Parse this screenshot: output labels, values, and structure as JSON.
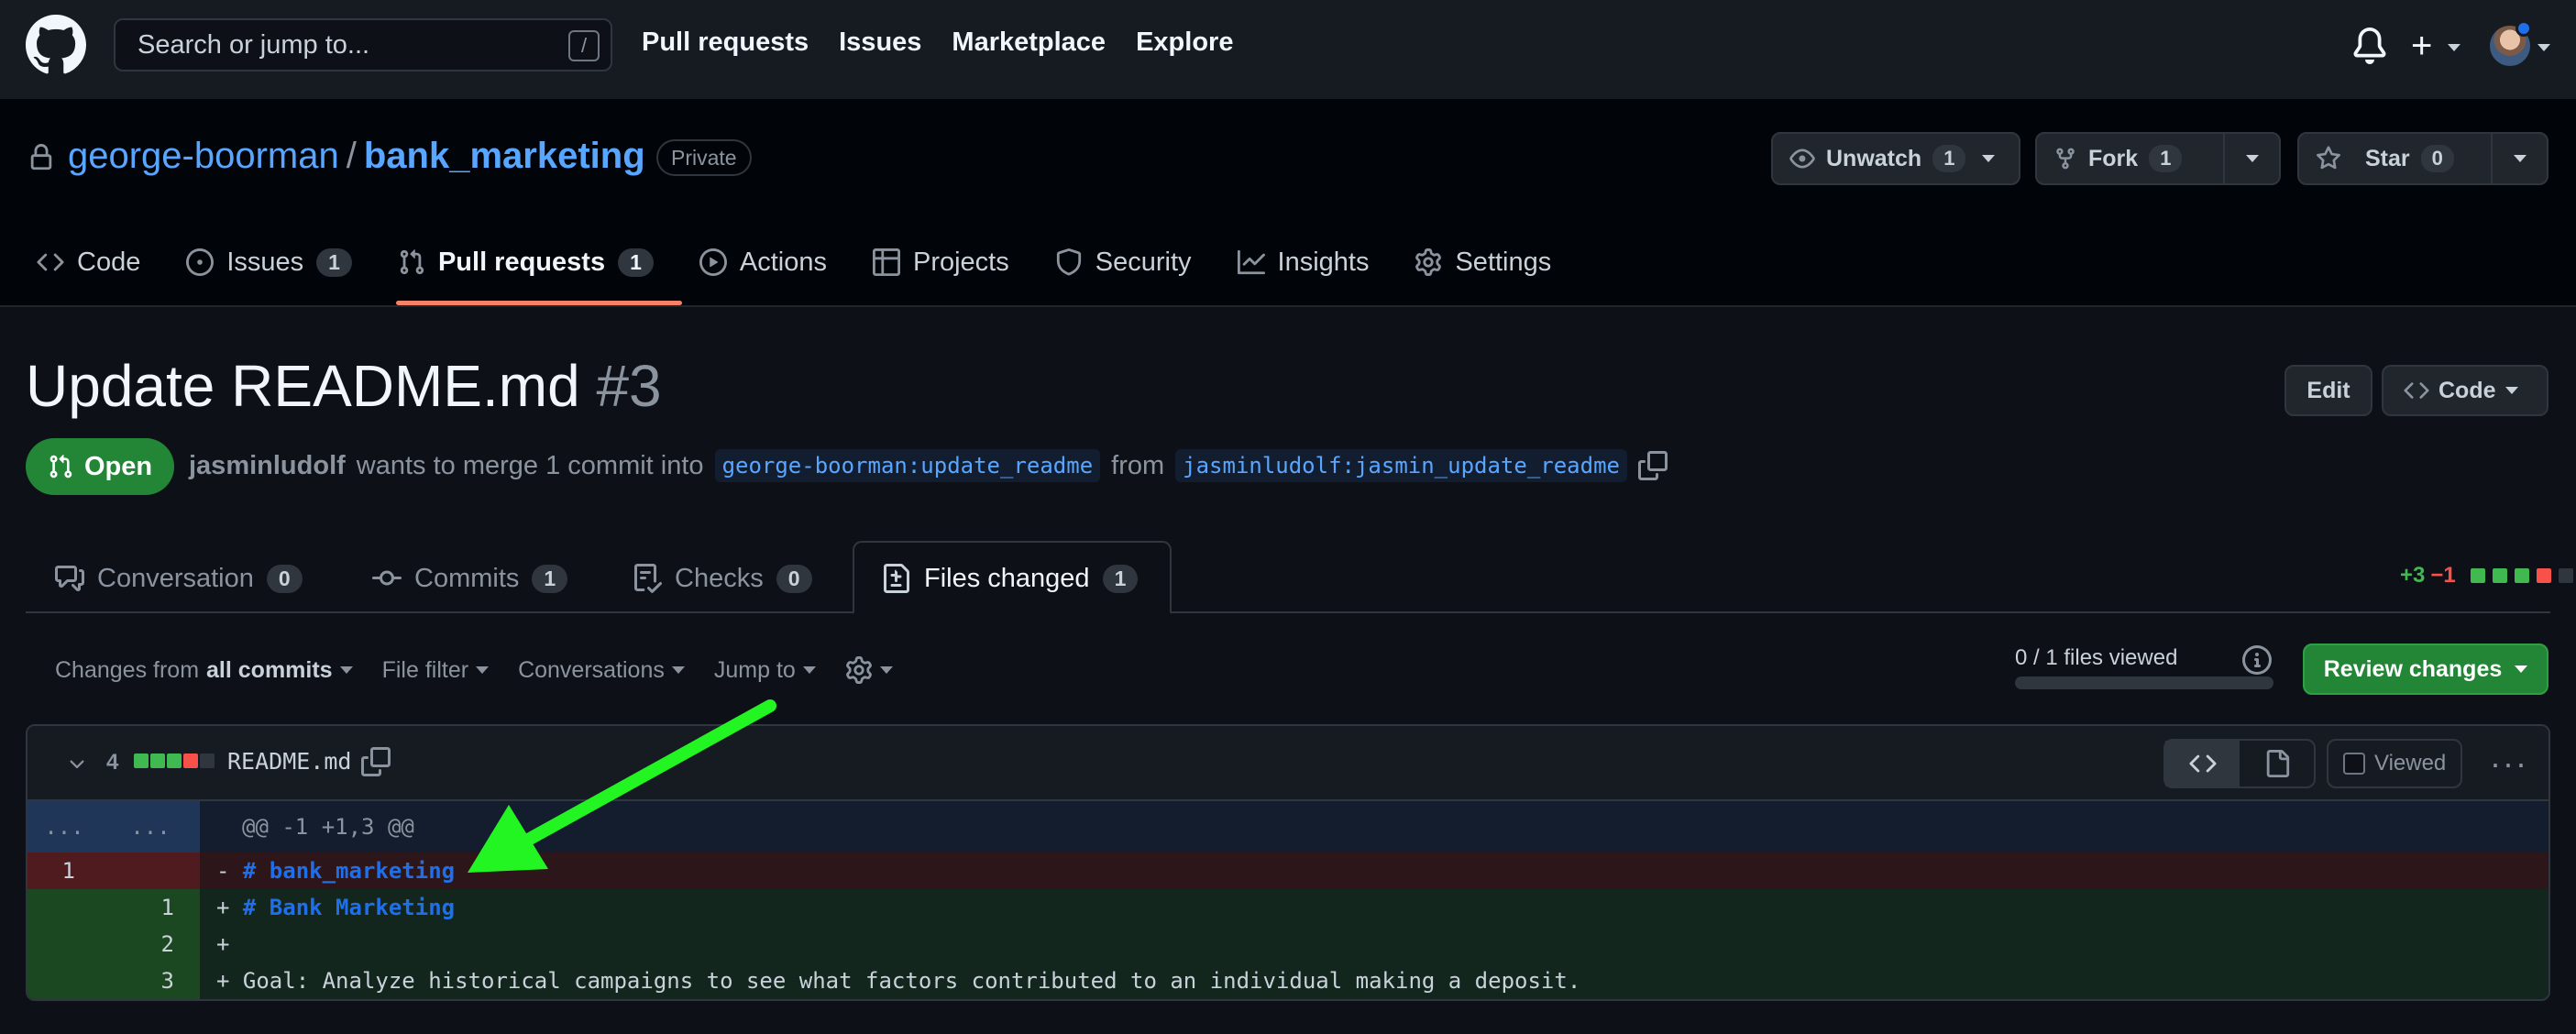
{
  "topbar": {
    "search_placeholder": "Search or jump to...",
    "search_shortcut": "/",
    "nav": [
      "Pull requests",
      "Issues",
      "Marketplace",
      "Explore"
    ],
    "plus": "+"
  },
  "repo": {
    "owner": "george-boorman",
    "separator": "/",
    "name": "bank_marketing",
    "visibility": "Private",
    "unwatch_label": "Unwatch",
    "unwatch_count": "1",
    "fork_label": "Fork",
    "fork_count": "1",
    "star_label": "Star",
    "star_count": "0"
  },
  "repo_tabs": [
    {
      "label": "Code",
      "count": null,
      "icon": "code-icon"
    },
    {
      "label": "Issues",
      "count": "1",
      "icon": "issue-icon"
    },
    {
      "label": "Pull requests",
      "count": "1",
      "icon": "pull-request-icon"
    },
    {
      "label": "Actions",
      "count": null,
      "icon": "play-icon"
    },
    {
      "label": "Projects",
      "count": null,
      "icon": "table-icon"
    },
    {
      "label": "Security",
      "count": null,
      "icon": "shield-icon"
    },
    {
      "label": "Insights",
      "count": null,
      "icon": "graph-icon"
    },
    {
      "label": "Settings",
      "count": null,
      "icon": "gear-icon"
    }
  ],
  "pr": {
    "title": "Update README.md",
    "number": "#3",
    "state": "Open",
    "author": "jasminludolf",
    "meta_text": "wants to merge 1 commit into",
    "base_branch": "george-boorman:update_readme",
    "from_text": "from",
    "head_branch": "jasminludolf:jasmin_update_readme",
    "edit_label": "Edit",
    "code_label": "Code"
  },
  "pr_tabs": [
    {
      "label": "Conversation",
      "count": "0"
    },
    {
      "label": "Commits",
      "count": "1"
    },
    {
      "label": "Checks",
      "count": "0"
    },
    {
      "label": "Files changed",
      "count": "1"
    }
  ],
  "diffstat": {
    "additions": "+3",
    "deletions": "−1",
    "colors": [
      "#3fb950",
      "#3fb950",
      "#3fb950",
      "#f85149",
      "#30363d"
    ]
  },
  "toolbar": {
    "changes_from": "Changes from",
    "changes_from_value": "all commits",
    "file_filter": "File filter",
    "conversations": "Conversations",
    "jump_to": "Jump to",
    "files_viewed": "0 / 1 files viewed",
    "files_viewed_fraction": 0,
    "review_changes": "Review changes"
  },
  "file": {
    "change_count": "4",
    "bars": [
      "#3fb950",
      "#3fb950",
      "#3fb950",
      "#f85149",
      "#30363d"
    ],
    "name": "README.md",
    "viewed_label": "Viewed",
    "more": "···"
  },
  "diff": {
    "hunk_left": "...",
    "hunk_right": "...",
    "hunk_header": "@@ -1 +1,3 @@",
    "lines": [
      {
        "type": "del",
        "old": "1",
        "new": "",
        "sign": "-",
        "text": "# bank_marketing"
      },
      {
        "type": "add",
        "old": "",
        "new": "1",
        "sign": "+",
        "text": "# Bank Marketing"
      },
      {
        "type": "add",
        "old": "",
        "new": "2",
        "sign": "+",
        "text": ""
      },
      {
        "type": "add",
        "old": "",
        "new": "3",
        "sign": "+",
        "text": "Goal: Analyze historical campaigns to see what factors contributed to an individual making a deposit."
      }
    ]
  },
  "annotation": {
    "color": "#22f522"
  }
}
